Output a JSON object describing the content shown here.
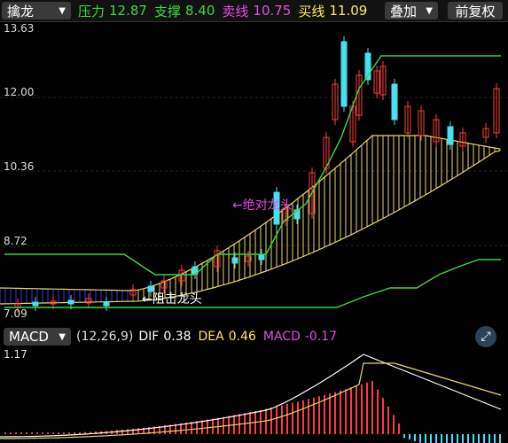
{
  "top_bar": {
    "indicator_label": "擒龙",
    "pressure_label": "压力",
    "pressure_value": "12.87",
    "support_label": "支撑",
    "support_value": "8.40",
    "sell_label": "卖线",
    "sell_value": "10.75",
    "buy_label": "买线",
    "buy_value": "11.09",
    "overlay_button": "叠加",
    "adjust_button": "前复权"
  },
  "main_chart": {
    "y_ticks": [
      "13.63",
      "12.00",
      "10.36",
      "8.72",
      "7.09"
    ],
    "annotation_top": "←绝对龙头",
    "annotation_bottom": "←阻击龙头",
    "colors": {
      "pressure_line": "#3dd63d",
      "ribbon": "#e8d66a",
      "ribbon_blue": "#3a3ae0",
      "up": "#ff3b3b",
      "down": "#48e0f0",
      "annotation_top": "#e050e0",
      "annotation_bottom": "#ffffff"
    }
  },
  "macd_bar": {
    "selector_label": "MACD",
    "params": "(12,26,9)",
    "dif_label": "DIF",
    "dif_value": "0.38",
    "dea_label": "DEA",
    "dea_value": "0.46",
    "macd_label": "MACD",
    "macd_value": "-0.17",
    "expand_icon": "expand-icon"
  },
  "macd_chart": {
    "y_tick": "1.17",
    "colors": {
      "dif": "#ffffff",
      "dea": "#e8d66a",
      "up": "#ff3b3b",
      "down": "#48e0f0"
    }
  }
}
